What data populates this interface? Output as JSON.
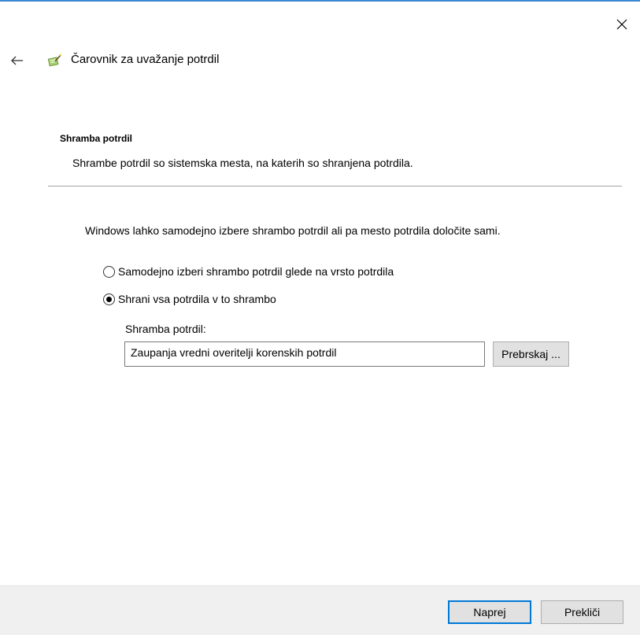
{
  "window": {
    "close_icon": "close-icon",
    "accent_color": "#3a88d0"
  },
  "header": {
    "back_icon": "back-arrow-icon",
    "wizard_icon": "certificate-wizard-icon",
    "title": "Čarovnik za uvažanje potrdil"
  },
  "section": {
    "title": "Shramba potrdil",
    "description": "Shrambe potrdil so sistemska mesta, na katerih so shranjena potrdila."
  },
  "main": {
    "intro": "Windows lahko samodejno izbere shrambo potrdil ali pa mesto potrdila določite sami.",
    "options": [
      {
        "label": "Samodejno izberi shrambo potrdil glede na vrsto potrdila",
        "checked": false
      },
      {
        "label": "Shrani vsa potrdila v to shrambo",
        "checked": true
      }
    ],
    "store_label": "Shramba potrdil:",
    "store_value": "Zaupanja vredni overitelji korenskih potrdil",
    "browse_label": "Prebrskaj ..."
  },
  "footer": {
    "next_label": "Naprej",
    "cancel_label": "Prekliči",
    "focus_color": "#0078d7"
  }
}
